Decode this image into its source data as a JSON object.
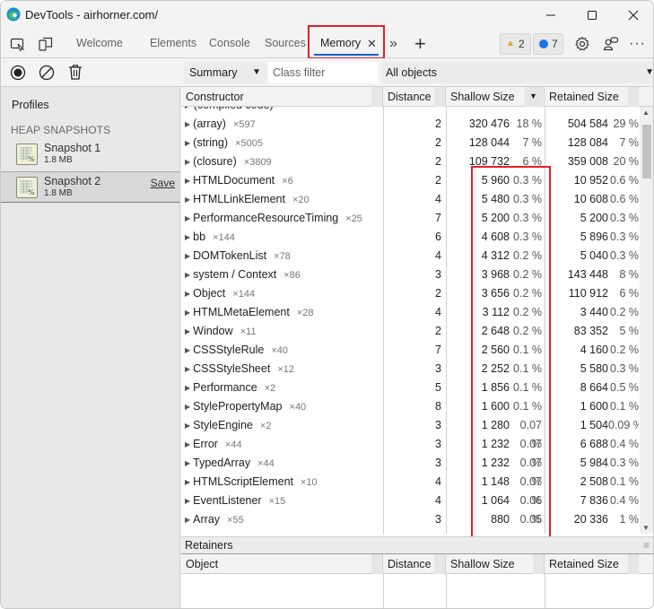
{
  "window": {
    "title": "DevTools - airhorner.com/",
    "minimize_icon": "minimize-icon",
    "maximize_icon": "maximize-icon",
    "close_icon": "close-icon"
  },
  "tabbar": {
    "tabs": [
      {
        "label": "Welcome"
      },
      {
        "label": "Elements"
      },
      {
        "label": "Console"
      },
      {
        "label": "Sources"
      },
      {
        "label": "Memory",
        "active": true
      }
    ],
    "more_tabs_glyph": "»",
    "new_tab_glyph": "+",
    "warnings_count": "2",
    "messages_count": "7"
  },
  "left_toolbar": {
    "record_icon": "record-icon",
    "clear_icon": "clear-icon",
    "delete_icon": "trash-icon"
  },
  "profiles": {
    "label": "Profiles",
    "section": "HEAP SNAPSHOTS",
    "snapshots": [
      {
        "name": "Snapshot 1",
        "size": "1.8 MB"
      },
      {
        "name": "Snapshot 2",
        "size": "1.8 MB",
        "save_label": "Save",
        "selected": true
      }
    ]
  },
  "toolbar": {
    "view_select": "Summary",
    "class_filter_placeholder": "Class filter",
    "objects_select": "All objects"
  },
  "grid": {
    "headers": {
      "constructor": "Constructor",
      "distance": "Distance",
      "shallow": "Shallow Size",
      "retained": "Retained Size"
    },
    "rows": [
      {
        "name": "(array)",
        "count": "×597",
        "distance": "2",
        "shallow": "320 476",
        "shallow_pct": "18 %",
        "retained": "504 584",
        "retained_pct": "29 %"
      },
      {
        "name": "(string)",
        "count": "×5005",
        "distance": "2",
        "shallow": "128 044",
        "shallow_pct": "7 %",
        "retained": "128 084",
        "retained_pct": "7 %"
      },
      {
        "name": "(closure)",
        "count": "×3809",
        "distance": "2",
        "shallow": "109 732",
        "shallow_pct": "6 %",
        "retained": "359 008",
        "retained_pct": "20 %"
      },
      {
        "name": "HTMLDocument",
        "count": "×6",
        "distance": "2",
        "shallow": "5 960",
        "shallow_pct": "0.3 %",
        "retained": "10 952",
        "retained_pct": "0.6 %"
      },
      {
        "name": "HTMLLinkElement",
        "count": "×20",
        "distance": "4",
        "shallow": "5 480",
        "shallow_pct": "0.3 %",
        "retained": "10 608",
        "retained_pct": "0.6 %"
      },
      {
        "name": "PerformanceResourceTiming",
        "count": "×25",
        "distance": "7",
        "shallow": "5 200",
        "shallow_pct": "0.3 %",
        "retained": "5 200",
        "retained_pct": "0.3 %"
      },
      {
        "name": "bb",
        "count": "×144",
        "distance": "6",
        "shallow": "4 608",
        "shallow_pct": "0.3 %",
        "retained": "5 896",
        "retained_pct": "0.3 %"
      },
      {
        "name": "DOMTokenList",
        "count": "×78",
        "distance": "4",
        "shallow": "4 312",
        "shallow_pct": "0.2 %",
        "retained": "5 040",
        "retained_pct": "0.3 %"
      },
      {
        "name": "system / Context",
        "count": "×86",
        "distance": "3",
        "shallow": "3 968",
        "shallow_pct": "0.2 %",
        "retained": "143 448",
        "retained_pct": "8 %"
      },
      {
        "name": "Object",
        "count": "×144",
        "distance": "2",
        "shallow": "3 656",
        "shallow_pct": "0.2 %",
        "retained": "110 912",
        "retained_pct": "6 %"
      },
      {
        "name": "HTMLMetaElement",
        "count": "×28",
        "distance": "4",
        "shallow": "3 112",
        "shallow_pct": "0.2 %",
        "retained": "3 440",
        "retained_pct": "0.2 %"
      },
      {
        "name": "Window",
        "count": "×11",
        "distance": "2",
        "shallow": "2 648",
        "shallow_pct": "0.2 %",
        "retained": "83 352",
        "retained_pct": "5 %"
      },
      {
        "name": "CSSStyleRule",
        "count": "×40",
        "distance": "7",
        "shallow": "2 560",
        "shallow_pct": "0.1 %",
        "retained": "4 160",
        "retained_pct": "0.2 %"
      },
      {
        "name": "CSSStyleSheet",
        "count": "×12",
        "distance": "3",
        "shallow": "2 252",
        "shallow_pct": "0.1 %",
        "retained": "5 580",
        "retained_pct": "0.3 %"
      },
      {
        "name": "Performance",
        "count": "×2",
        "distance": "5",
        "shallow": "1 856",
        "shallow_pct": "0.1 %",
        "retained": "8 664",
        "retained_pct": "0.5 %"
      },
      {
        "name": "StylePropertyMap",
        "count": "×40",
        "distance": "8",
        "shallow": "1 600",
        "shallow_pct": "0.1 %",
        "retained": "1 600",
        "retained_pct": "0.1 %"
      },
      {
        "name": "StyleEngine",
        "count": "×2",
        "distance": "3",
        "shallow": "1 280",
        "shallow_pct": "0.07 %",
        "retained": "1 504",
        "retained_pct": "0.09 %"
      },
      {
        "name": "Error",
        "count": "×44",
        "distance": "3",
        "shallow": "1 232",
        "shallow_pct": "0.07 %",
        "retained": "6 688",
        "retained_pct": "0.4 %"
      },
      {
        "name": "TypedArray",
        "count": "×44",
        "distance": "3",
        "shallow": "1 232",
        "shallow_pct": "0.07 %",
        "retained": "5 984",
        "retained_pct": "0.3 %"
      },
      {
        "name": "HTMLScriptElement",
        "count": "×10",
        "distance": "4",
        "shallow": "1 148",
        "shallow_pct": "0.07 %",
        "retained": "2 508",
        "retained_pct": "0.1 %"
      },
      {
        "name": "EventListener",
        "count": "×15",
        "distance": "4",
        "shallow": "1 064",
        "shallow_pct": "0.06 %",
        "retained": "7 836",
        "retained_pct": "0.4 %"
      },
      {
        "name": "Array",
        "count": "×55",
        "distance": "3",
        "shallow": "880",
        "shallow_pct": "0.05 %",
        "retained": "20 336",
        "retained_pct": "1 %"
      }
    ]
  },
  "retainers": {
    "title": "Retainers",
    "headers": {
      "object": "Object",
      "distance": "Distance",
      "shallow": "Shallow Size",
      "retained": "Retained Size"
    }
  },
  "colors": {
    "highlight": "#e0202a",
    "active_tab_underline": "#0a64c8",
    "warning": "#f0a020",
    "info": "#1a73e8"
  }
}
